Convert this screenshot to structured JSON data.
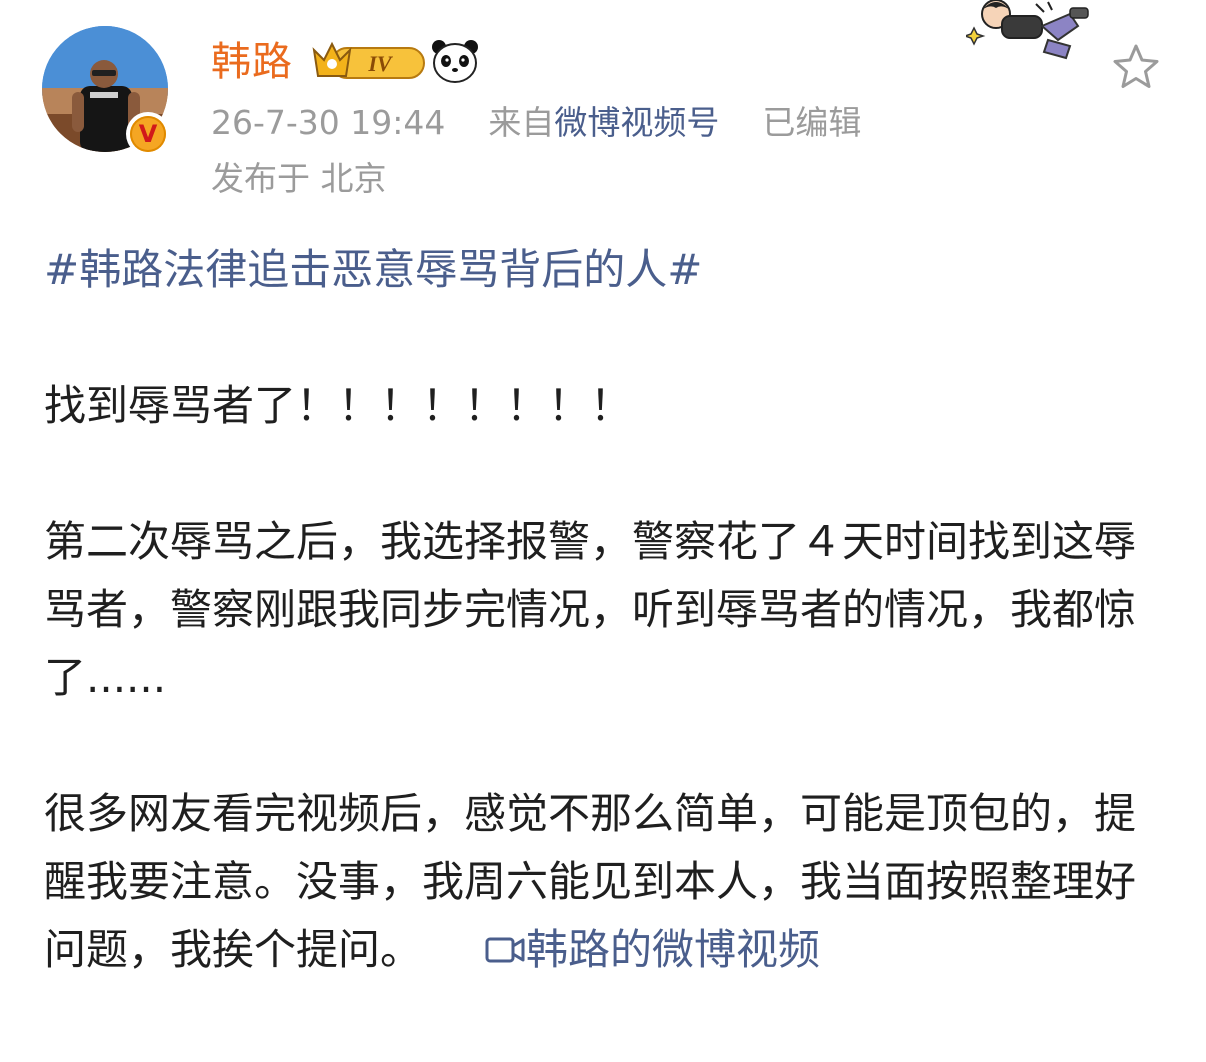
{
  "post": {
    "author": {
      "name": "韩路",
      "level": "IV",
      "verified_mark": "V"
    },
    "timestamp": "26-7-30 19:44",
    "source_prefix": "来自",
    "source_name": "微博视频号",
    "edited": "已编辑",
    "location": "发布于 北京",
    "topic": "#韩路法律追击恶意辱骂背后的人#",
    "paragraphs": [
      "找到辱骂者了！！！！！！！！",
      "第二次辱骂之后，我选择报警，警察花了４天时间找到这辱骂者，警察刚跟我同步完情况，听到辱骂者的情况，我都惊了......",
      "很多网友看完视频后，感觉不那么简单，可能是顶包的，提醒我要注意。没事，我周六能见到本人，我当面按照整理好问题，我挨个提问。"
    ],
    "video_link": "韩路的微博视频"
  },
  "icons": {
    "favorite": "star-outline-icon",
    "video": "video-camera-icon",
    "level": "crown-level-badge",
    "emblem": "panda-icon",
    "decor": "cartoon-decoration"
  },
  "colors": {
    "username": "#ea6b1e",
    "link": "#4a5e8c",
    "meta": "#9b9b9b",
    "text": "#1f1f1f"
  }
}
